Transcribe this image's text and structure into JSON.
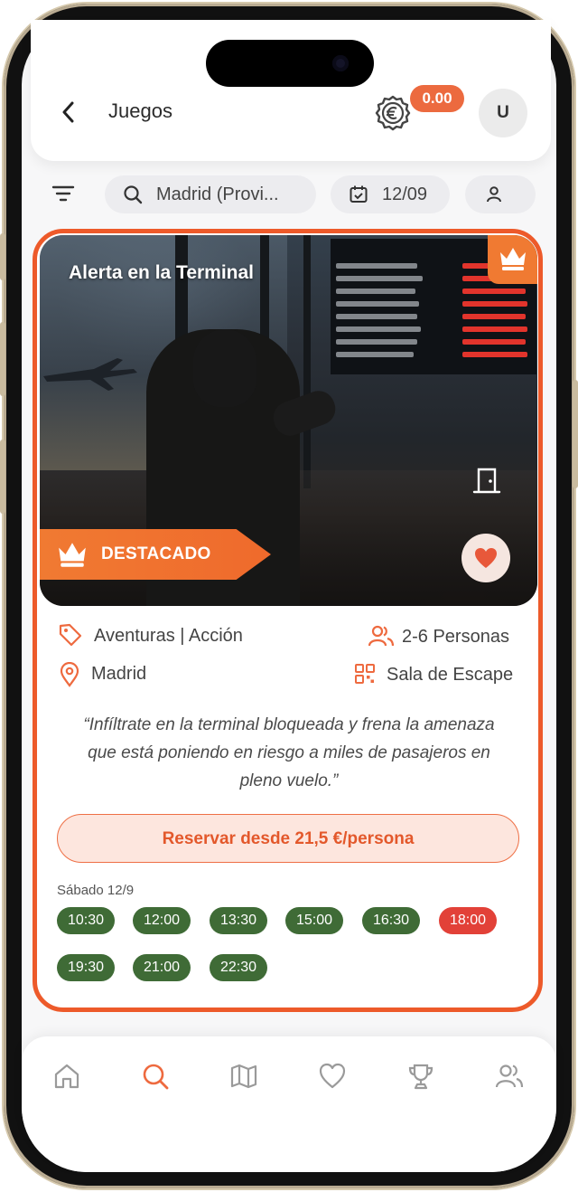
{
  "header": {
    "title": "Juegos",
    "balance": "0.00",
    "avatar_initial": "U"
  },
  "search": {
    "location": "Madrid (Provi...",
    "date": "12/09"
  },
  "card": {
    "title": "Alerta en la Terminal",
    "featured_label": "DESTACADO",
    "category": "Aventuras | Acción",
    "players": "2-6 Personas",
    "city": "Madrid",
    "type": "Sala de Escape",
    "description": "“Infíltrate en la terminal bloqueada y frena la amenaza que está poniendo en riesgo a miles de pasajeros en pleno vuelo.”",
    "reserve_label": "Reservar desde 21,5 €/persona",
    "day_label": "Sábado 12/9",
    "slots": [
      {
        "time": "10:30",
        "available": true
      },
      {
        "time": "12:00",
        "available": true
      },
      {
        "time": "13:30",
        "available": true
      },
      {
        "time": "15:00",
        "available": true
      },
      {
        "time": "16:30",
        "available": true
      },
      {
        "time": "18:00",
        "available": false
      },
      {
        "time": "19:30",
        "available": true
      },
      {
        "time": "21:00",
        "available": true
      },
      {
        "time": "22:30",
        "available": true
      }
    ]
  },
  "nav": {
    "items": [
      "home-icon",
      "search-icon",
      "map-icon",
      "heart-icon",
      "trophy-icon",
      "users-icon"
    ],
    "active": "search-icon"
  },
  "colors": {
    "accent": "#ed5a2a",
    "slot_available": "#3f6b36",
    "slot_unavailable": "#e24138",
    "balance_badge": "#ec6a3f"
  }
}
